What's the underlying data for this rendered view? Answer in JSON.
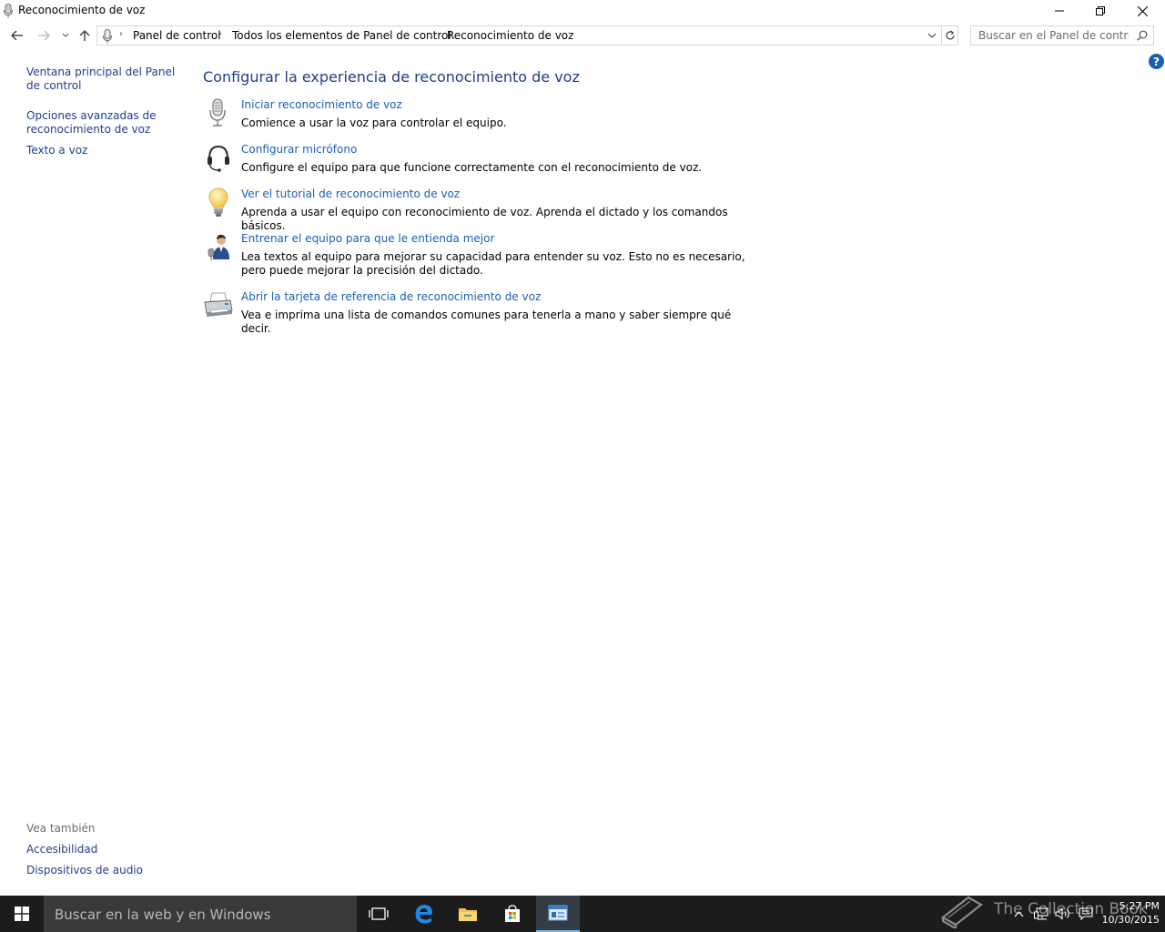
{
  "window": {
    "title": "Reconocimiento de voz",
    "controls": {
      "minimize": "minimize",
      "maximize": "restore",
      "close": "close"
    }
  },
  "address_bar": {
    "breadcrumbs": [
      "Panel de control",
      "Todos los elementos de Panel de control",
      "Reconocimiento de voz"
    ]
  },
  "search": {
    "placeholder": "Buscar en el Panel de control"
  },
  "left_pane": {
    "links": [
      "Ventana principal del Panel de control",
      "Opciones avanzadas de reconocimiento de voz",
      "Texto a voz"
    ],
    "see_also": {
      "title": "Vea también",
      "links": [
        "Accesibilidad",
        "Dispositivos de audio"
      ]
    }
  },
  "main": {
    "heading": "Configurar la experiencia de reconocimiento de voz",
    "tasks": [
      {
        "icon": "microphone-icon",
        "link": "Iniciar reconocimiento de voz",
        "desc": "Comience a usar la voz para controlar el equipo."
      },
      {
        "icon": "headset-icon",
        "link": "Configurar micrófono",
        "desc": "Configure el equipo para que funcione correctamente con el reconocimiento de voz."
      },
      {
        "icon": "lightbulb-icon",
        "link": "Ver el tutorial de reconocimiento de voz",
        "desc": "Aprenda a usar el equipo con reconocimiento de voz. Aprenda el dictado y los comandos básicos."
      },
      {
        "icon": "user-training-icon",
        "link": "Entrenar el equipo para que le entienda mejor",
        "desc": "Lea textos al equipo para mejorar su capacidad para entender su voz. Esto no es necesario, pero puede mejorar la precisión del dictado."
      },
      {
        "icon": "printer-icon",
        "link": "Abrir la tarjeta de referencia de reconocimiento de voz",
        "desc": "Vea e imprima una lista de comandos comunes para tenerla a mano y saber siempre qué decir."
      }
    ]
  },
  "taskbar": {
    "search_placeholder": "Buscar en la web y en Windows",
    "watermark": "The Collection Book",
    "time": "5:27 PM",
    "date": "10/30/2015"
  },
  "colors": {
    "link": "#1a5fb4",
    "heading": "#1e3d8f",
    "taskbar": "#1c1c1c",
    "taskbar_active": "#76b9ed"
  }
}
